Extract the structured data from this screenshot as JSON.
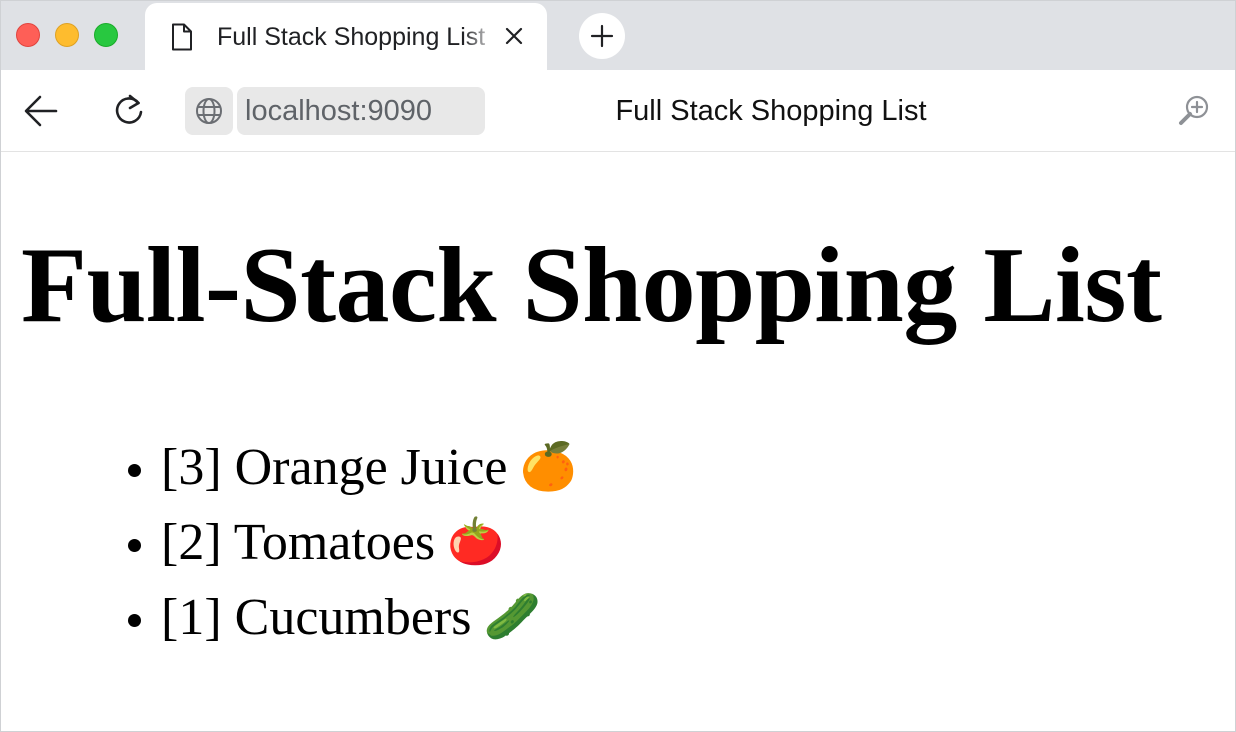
{
  "browser": {
    "tab": {
      "title": "Full Stack Shopping List"
    },
    "address_bar": {
      "url": "localhost:9090"
    },
    "toolbar_title": "Full Stack Shopping List",
    "icons": {
      "tab_page": "page-icon",
      "tab_close": "close-icon",
      "new_tab": "plus-icon",
      "back": "arrow-left-icon",
      "reload": "reload-icon",
      "site": "globe-icon",
      "zoom": "zoom-in-icon"
    },
    "colors": {
      "close": "#fe5f57",
      "minimize": "#febc2e",
      "maximize": "#28c840",
      "tabstrip": "#dfe1e5",
      "url_box": "#e8e8e8"
    }
  },
  "page": {
    "heading": "Full-Stack Shopping List",
    "items": [
      {
        "label": "[3] Orange Juice",
        "emoji": "🍊"
      },
      {
        "label": "[2] Tomatoes",
        "emoji": "🍅"
      },
      {
        "label": "[1] Cucumbers",
        "emoji": "🥒"
      }
    ]
  }
}
